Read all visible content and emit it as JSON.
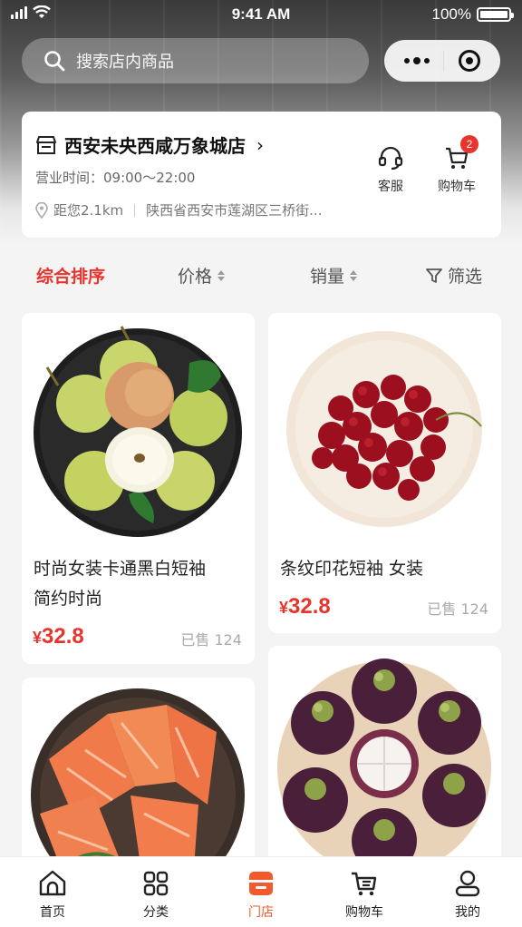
{
  "status_bar": {
    "time": "9:41 AM",
    "battery": "100%"
  },
  "search": {
    "placeholder": "搜索店内商品"
  },
  "store": {
    "name": "西安未央西咸万象城店",
    "hours": "营业时间：09:00～22:00",
    "distance": "距您2.1km",
    "address": "陕西省西安市莲湖区三桥街...",
    "actions": {
      "service": "客服",
      "cart": "购物车",
      "cart_count": "2"
    }
  },
  "sort": {
    "comprehensive": "综合排序",
    "price": "价格",
    "sales": "销量",
    "filter": "筛选"
  },
  "products": [
    {
      "title_line1": "时尚女装卡通黑白短袖",
      "title_line2": "简约时尚",
      "currency": "¥",
      "price": "32.8",
      "sold": "已售 124",
      "image": "pears-plate"
    },
    {
      "title_line1": "条纹印花短袖 女装",
      "title_line2": "",
      "currency": "¥",
      "price": "32.8",
      "sold": "已售 124",
      "image": "cherries-plate"
    },
    {
      "title_line1": "",
      "title_line2": "",
      "currency": "",
      "price": "",
      "sold": "",
      "image": "salmon-plate"
    },
    {
      "title_line1": "",
      "title_line2": "",
      "currency": "",
      "price": "",
      "sold": "",
      "image": "mangosteen-plate"
    }
  ],
  "tabs": [
    {
      "label": "首页",
      "icon": "home-icon"
    },
    {
      "label": "分类",
      "icon": "grid-icon"
    },
    {
      "label": "门店",
      "icon": "store-icon",
      "active": true
    },
    {
      "label": "购物车",
      "icon": "cart-icon"
    },
    {
      "label": "我的",
      "icon": "user-icon"
    }
  ],
  "colors": {
    "accent": "#e8342c",
    "tab_active": "#f25a2e"
  }
}
